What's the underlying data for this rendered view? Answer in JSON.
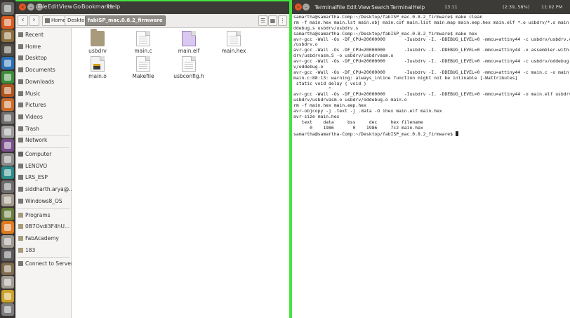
{
  "launcher": {
    "items": [
      {
        "icon": "ubuntu-dash-icon",
        "color": "#6b6a66"
      },
      {
        "icon": "firefox-icon",
        "color": "#d65b1f"
      },
      {
        "icon": "files-icon",
        "color": "#8a6d3b"
      },
      {
        "icon": "terminal-icon",
        "color": "#4e4a45"
      },
      {
        "icon": "libreoffice-writer-icon",
        "color": "#2a6fb5"
      },
      {
        "icon": "libreoffice-calc-icon",
        "color": "#3c8c3a"
      },
      {
        "icon": "libreoffice-impress-icon",
        "color": "#b0541b"
      },
      {
        "icon": "software-center-icon",
        "color": "#c96b2c"
      },
      {
        "icon": "amazon-icon",
        "color": "#6e6e6e"
      },
      {
        "icon": "system-settings-icon",
        "color": "#9a9a9a"
      },
      {
        "icon": "application-icon",
        "color": "#7a4e8a"
      },
      {
        "icon": "usb-drive-icon",
        "color": "#8c8c8c"
      },
      {
        "icon": "arduino-icon",
        "color": "#2b8a8a"
      },
      {
        "icon": "monitor-icon",
        "color": "#6c6c6c"
      },
      {
        "icon": "disk-icon",
        "color": "#a19a8c"
      },
      {
        "icon": "chart-icon",
        "color": "#6a7f3c"
      },
      {
        "icon": "blender-icon",
        "color": "#e07b1f"
      },
      {
        "icon": "disk-icon",
        "color": "#9c978f"
      },
      {
        "icon": "inkscape-icon",
        "color": "#5a5a5a"
      },
      {
        "icon": "gimp-icon",
        "color": "#7e6a4c"
      },
      {
        "icon": "disk-icon",
        "color": "#a09b93"
      },
      {
        "icon": "scratch-icon",
        "color": "#c9a227"
      },
      {
        "icon": "trash-icon",
        "color": "#7c7c7c"
      }
    ]
  },
  "files": {
    "menu": [
      "File",
      "Edit",
      "View",
      "Go",
      "Bookmarks",
      "Help"
    ],
    "back_label": "‹",
    "forward_label": "›",
    "crumbs": [
      "Home",
      "Desktop",
      "fabISP_mac.0.8.2_firmware"
    ],
    "view_buttons": [
      "☰",
      "▦",
      "⋮"
    ],
    "sidebar": {
      "places": [
        {
          "label": "Recent",
          "icon": "clock-icon"
        },
        {
          "label": "Home",
          "icon": "home-icon"
        },
        {
          "label": "Desktop",
          "icon": "desktop-icon"
        },
        {
          "label": "Documents",
          "icon": "documents-icon"
        },
        {
          "label": "Downloads",
          "icon": "downloads-icon"
        },
        {
          "label": "Music",
          "icon": "music-icon"
        },
        {
          "label": "Pictures",
          "icon": "pictures-icon"
        },
        {
          "label": "Videos",
          "icon": "videos-icon"
        },
        {
          "label": "Trash",
          "icon": "trash-icon"
        }
      ],
      "network": [
        {
          "label": "Network",
          "icon": "network-icon"
        }
      ],
      "devices": [
        {
          "label": "Computer",
          "icon": "computer-icon"
        },
        {
          "label": "LENOVO",
          "icon": "drive-icon"
        },
        {
          "label": "LRS_ESP",
          "icon": "drive-icon"
        },
        {
          "label": "siddharth.arya@...",
          "icon": "drive-icon"
        },
        {
          "label": "Windows8_OS",
          "icon": "drive-icon"
        }
      ],
      "bookmarks": [
        {
          "label": "Programs",
          "icon": "folder-icon"
        },
        {
          "label": "0B7Ovdi3F4hU...",
          "icon": "folder-icon"
        },
        {
          "label": "FabAcademy",
          "icon": "folder-icon"
        },
        {
          "label": "183",
          "icon": "folder-icon"
        }
      ],
      "connect": {
        "label": "Connect to Server",
        "icon": "connect-server-icon"
      }
    },
    "items": [
      {
        "name": "usbdrv",
        "type": "folder"
      },
      {
        "name": "main.c",
        "type": "doc"
      },
      {
        "name": "main.elf",
        "type": "elf"
      },
      {
        "name": "main.hex",
        "type": "doc"
      },
      {
        "name": "main.o",
        "type": "obj"
      },
      {
        "name": "Makefile",
        "type": "doc"
      },
      {
        "name": "usbconfig.h",
        "type": "doc"
      }
    ]
  },
  "terminal": {
    "menu": [
      "Terminal",
      "File",
      "Edit",
      "View",
      "Search",
      "Terminal",
      "Help"
    ],
    "tray": {
      "clock": "11:02 PM",
      "battery": "(2:39, 58%)",
      "time_small": "13:11"
    },
    "lines": [
      "samartha@samartha-Comp:~/Desktop/fabISP_mac.0.8.2_firmware$ make clean",
      "rm -f main.hex main.lst main.obj main.cof main.list main.map main.eep.hex main.elf *.o usbdrv/*.o main.s usbdrv/o",
      "ddebug.s usbdrv/usbdrv.s",
      "samartha@samartha-Comp:~/Desktop/fabISP_mac.0.8.2_firmware$ make hex",
      "avr-gcc -Wall -Os -DF_CPU=20000000       -Iusbdrv -I. -DDEBUG_LEVEL=0 -mmcu=attiny44 -c usbdrv/usbdrv.c -o usbdrv",
      "/usbdrv.o",
      "avr-gcc -Wall -Os -DF_CPU=20000000       -Iusbdrv -I. -DDEBUG_LEVEL=0 -mmcu=attiny44 -x assembler-with-cpp -c usb",
      "drv/usbdrvasm.S -o usbdrv/usbdrvasm.o",
      "avr-gcc -Wall -Os -DF_CPU=20000000       -Iusbdrv -I. -DDEBUG_LEVEL=0 -mmcu=attiny44 -c usbdrv/oddebug.c -o usbdr",
      "v/oddebug.o",
      "avr-gcc -Wall -Os -DF_CPU=20000000       -Iusbdrv -I. -DDEBUG_LEVEL=0 -mmcu=attiny44 -c main.c -o main.o",
      "main.c:88:13: warning: always_inline function might not be inlinable [-Wattributes]",
      " static void delay ( void )",
      "             ^",
      "avr-gcc -Wall -Os -DF_CPU=20000000       -Iusbdrv -I. -DDEBUG_LEVEL=0 -mmcu=attiny44 -o main.elf usbdrv/usbdrv.o",
      "usbdrv/usbdrvasm.o usbdrv/oddebug.o main.o",
      "rm -f main.hex main.eep.hex",
      "avr-objcopy -j .text -j .data -O ihex main.elf main.hex",
      "avr-size main.hex",
      "   text    data     bss     dec     hex filename",
      "      0    1986       0    1986     7c2 main.hex"
    ],
    "prompt": "samartha@samartha-Comp:~/Desktop/fabISP_mac.0.8.2_firmware$ "
  }
}
